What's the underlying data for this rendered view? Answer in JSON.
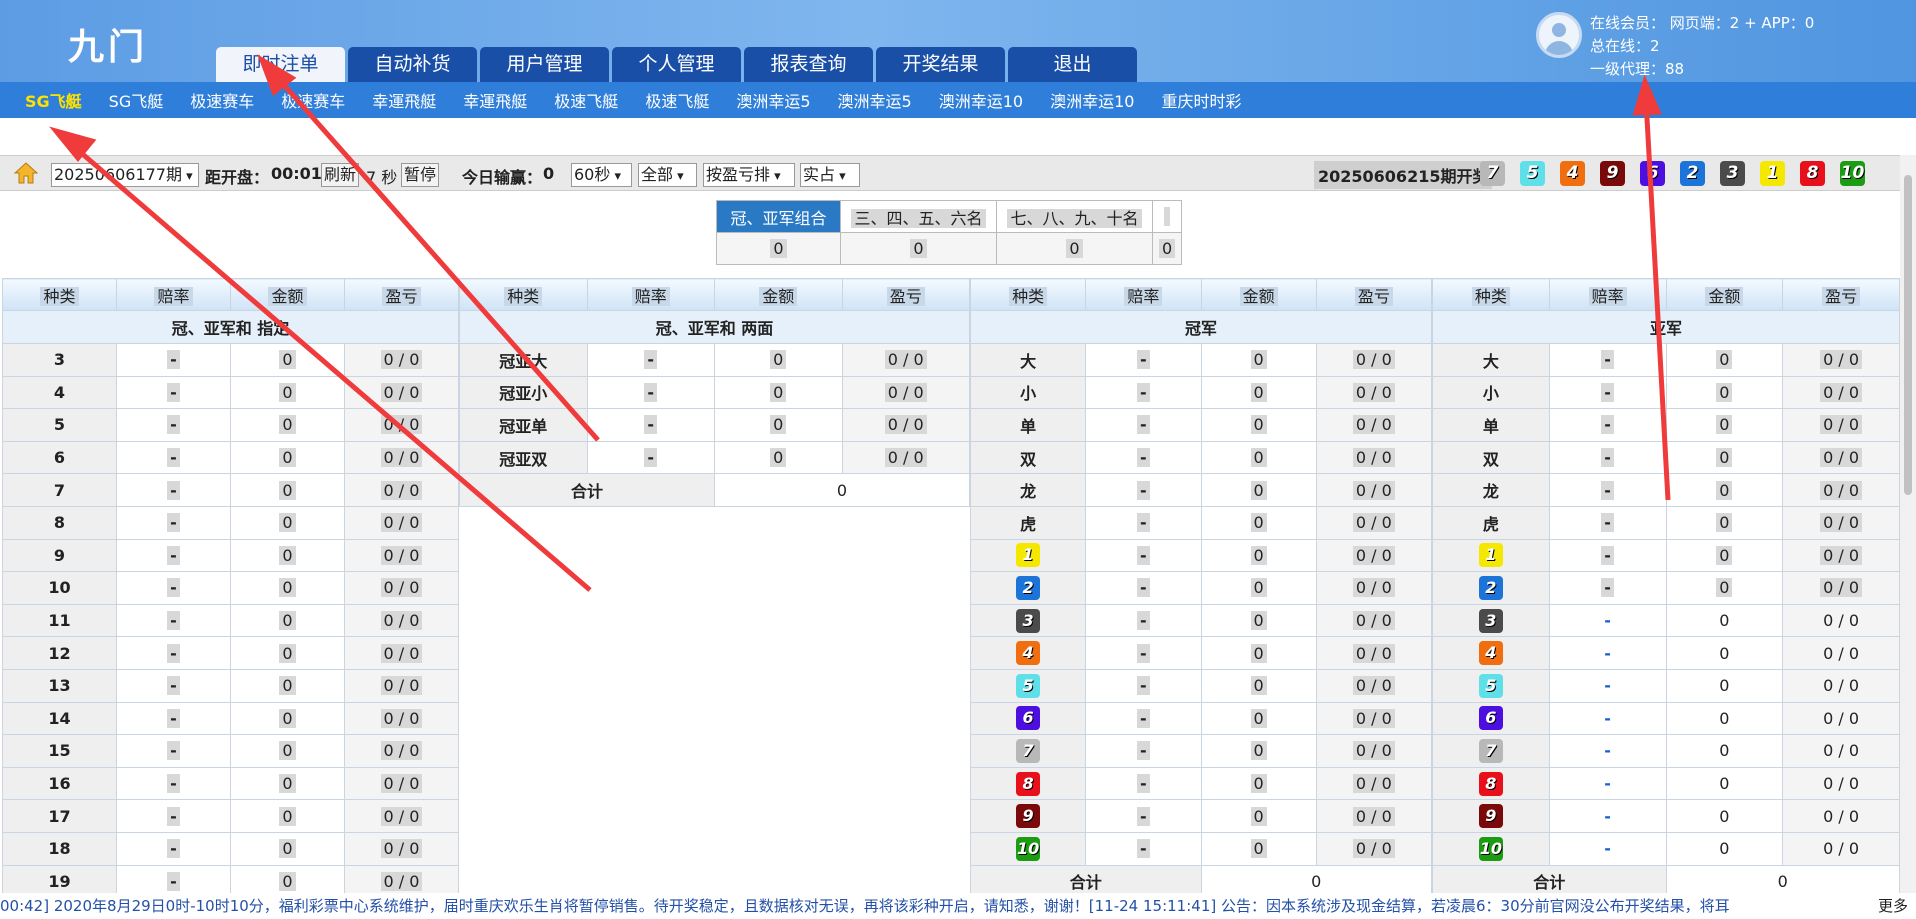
{
  "header": {
    "logo": "九门",
    "tabs": [
      "即时注单",
      "自动补货",
      "用户管理",
      "个人管理",
      "报表查询",
      "开奖结果",
      "退出"
    ],
    "active_tab": "即时注单",
    "online_members": "在线会员： 网页端：2 + APP：0",
    "total_online": "总在线：2",
    "level1_agents": "一级代理：88"
  },
  "games": [
    "SG飞艇",
    "SG飞艇",
    "极速赛车",
    "极速赛车",
    "幸運飛艇",
    "幸運飛艇",
    "极速飞艇",
    "极速飞艇",
    "澳洲幸运5",
    "澳洲幸运5",
    "澳洲幸运10",
    "澳洲幸运10",
    "重庆时时彩"
  ],
  "controls": {
    "period": "20250606177期",
    "countdown_label": "距开盘：",
    "countdown": "00:01",
    "refresh": "刷新",
    "seconds": "7 秒",
    "pause": "暂停",
    "today_label": "今日输赢：",
    "today_value": "0",
    "interval": "60秒",
    "scope": "全部",
    "sort": "按盈亏排",
    "mode": "实占",
    "draw_label": "20250606215期开奖"
  },
  "draw_numbers": [
    "7",
    "5",
    "4",
    "9",
    "6",
    "2",
    "3",
    "1",
    "8",
    "10"
  ],
  "number_colors": {
    "1": "#f5e800",
    "2": "#1c74d9",
    "3": "#4b4b4b",
    "4": "#f06d10",
    "5": "#5fdfe8",
    "6": "#4d0fe0",
    "7": "#b8b8b8",
    "8": "#e8101a",
    "9": "#7a0a0a",
    "10": "#1b9c12"
  },
  "summary": {
    "headers": [
      "冠、亚军组合",
      "三、四、五、六名",
      "七、八、九、十名",
      ""
    ],
    "values": [
      "0",
      "0",
      "0",
      "0"
    ]
  },
  "columns": [
    "种类",
    "赔率",
    "金额",
    "盈亏"
  ],
  "panel1": {
    "title": "冠、亚军和 指定",
    "rows": [
      [
        "3",
        "-",
        "0",
        "0 / 0"
      ],
      [
        "4",
        "-",
        "0",
        "0 / 0"
      ],
      [
        "5",
        "-",
        "0",
        "0 / 0"
      ],
      [
        "6",
        "-",
        "0",
        "0 / 0"
      ],
      [
        "7",
        "-",
        "0",
        "0 / 0"
      ],
      [
        "8",
        "-",
        "0",
        "0 / 0"
      ],
      [
        "9",
        "-",
        "0",
        "0 / 0"
      ],
      [
        "10",
        "-",
        "0",
        "0 / 0"
      ],
      [
        "11",
        "-",
        "0",
        "0 / 0"
      ],
      [
        "12",
        "-",
        "0",
        "0 / 0"
      ],
      [
        "13",
        "-",
        "0",
        "0 / 0"
      ],
      [
        "14",
        "-",
        "0",
        "0 / 0"
      ],
      [
        "15",
        "-",
        "0",
        "0 / 0"
      ],
      [
        "16",
        "-",
        "0",
        "0 / 0"
      ],
      [
        "17",
        "-",
        "0",
        "0 / 0"
      ],
      [
        "18",
        "-",
        "0",
        "0 / 0"
      ],
      [
        "19",
        "-",
        "0",
        "0 / 0"
      ]
    ]
  },
  "panel2": {
    "title": "冠、亚军和 两面",
    "rows": [
      [
        "冠亚大",
        "-",
        "0",
        "0 / 0"
      ],
      [
        "冠亚小",
        "-",
        "0",
        "0 / 0"
      ],
      [
        "冠亚单",
        "-",
        "0",
        "0 / 0"
      ],
      [
        "冠亚双",
        "-",
        "0",
        "0 / 0"
      ]
    ],
    "total_label": "合计",
    "total": "0"
  },
  "panel3": {
    "title": "冠军",
    "rows": [
      [
        "大",
        "-",
        "0",
        "0 / 0"
      ],
      [
        "小",
        "-",
        "0",
        "0 / 0"
      ],
      [
        "单",
        "-",
        "0",
        "0 / 0"
      ],
      [
        "双",
        "-",
        "0",
        "0 / 0"
      ],
      [
        "龙",
        "-",
        "0",
        "0 / 0"
      ],
      [
        "虎",
        "-",
        "0",
        "0 / 0"
      ],
      [
        "1",
        "-",
        "0",
        "0 / 0"
      ],
      [
        "2",
        "-",
        "0",
        "0 / 0"
      ],
      [
        "3",
        "-",
        "0",
        "0 / 0"
      ],
      [
        "4",
        "-",
        "0",
        "0 / 0"
      ],
      [
        "5",
        "-",
        "0",
        "0 / 0"
      ],
      [
        "6",
        "-",
        "0",
        "0 / 0"
      ],
      [
        "7",
        "-",
        "0",
        "0 / 0"
      ],
      [
        "8",
        "-",
        "0",
        "0 / 0"
      ],
      [
        "9",
        "-",
        "0",
        "0 / 0"
      ],
      [
        "10",
        "-",
        "0",
        "0 / 0"
      ]
    ],
    "total_label": "合计",
    "total": "0"
  },
  "panel4": {
    "title": "亚军",
    "rows": [
      [
        "大",
        "-",
        "0",
        "0 / 0"
      ],
      [
        "小",
        "-",
        "0",
        "0 / 0"
      ],
      [
        "单",
        "-",
        "0",
        "0 / 0"
      ],
      [
        "双",
        "-",
        "0",
        "0 / 0"
      ],
      [
        "龙",
        "-",
        "0",
        "0 / 0"
      ],
      [
        "虎",
        "-",
        "0",
        "0 / 0"
      ],
      [
        "1",
        "-",
        "0",
        "0 / 0"
      ],
      [
        "2",
        "-",
        "0",
        "0 / 0"
      ],
      [
        "3",
        "-",
        "0",
        "0 / 0"
      ],
      [
        "4",
        "-",
        "0",
        "0 / 0"
      ],
      [
        "5",
        "-",
        "0",
        "0 / 0"
      ],
      [
        "6",
        "-",
        "0",
        "0 / 0"
      ],
      [
        "7",
        "-",
        "0",
        "0 / 0"
      ],
      [
        "8",
        "-",
        "0",
        "0 / 0"
      ],
      [
        "9",
        "-",
        "0",
        "0 / 0"
      ],
      [
        "10",
        "-",
        "0",
        "0 / 0"
      ]
    ],
    "total_label": "合计",
    "total": "0"
  },
  "footer": {
    "notice": "00:42] 2020年8月29日0时-10时10分，福利彩票中心系统维护，届时重庆欢乐生肖将暂停销售。待开奖稳定，且数据核对无误，再将该彩种开启，请知悉，谢谢！[11-24 15:11:41] 公告：因本系统涉及现金结算，若凌晨6：30分前官网没公布开奖结果，将耳",
    "more": "更多"
  }
}
